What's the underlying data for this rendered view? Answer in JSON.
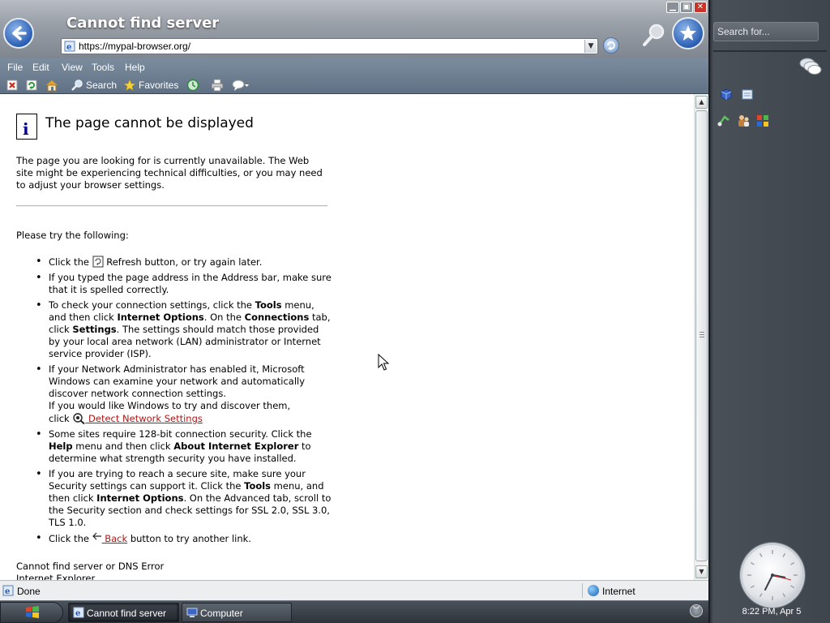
{
  "window": {
    "title": "Cannot find server",
    "address": "https://mypal-browser.org/",
    "controls": {
      "minimize": "▁",
      "maximize": "▣",
      "close": "✕"
    }
  },
  "menubar": {
    "items": [
      "File",
      "Edit",
      "View",
      "Tools",
      "Help"
    ]
  },
  "toolbar": {
    "search_label": "Search",
    "favorites_label": "Favorites"
  },
  "page": {
    "heading": "The page cannot be displayed",
    "intro": "The page you are looking for is currently unavailable. The Web site might be experiencing technical difficulties, or you may need to adjust your browser settings.",
    "try_label": "Please try the following:",
    "tip1_pre": "Click the ",
    "tip1_post": " Refresh button, or try again later.",
    "tip2": "If you typed the page address in the Address bar, make sure that it is spelled correctly.",
    "tip3_a": "To check your connection settings, click the ",
    "tip3_b": "Tools",
    "tip3_c": " menu, and then click ",
    "tip3_d": "Internet Options",
    "tip3_e": ". On the ",
    "tip3_f": "Connections",
    "tip3_g": " tab, click ",
    "tip3_h": "Settings",
    "tip3_i": ". The settings should match those provided by your local area network (LAN) administrator or Internet service provider (ISP).",
    "tip4_a": "If your Network Administrator has enabled it, Microsoft Windows can examine your network and automatically discover network connection settings.",
    "tip4_b": "If you would like Windows to try and discover them,",
    "tip4_c": "click ",
    "tip4_link": " Detect Network Settings",
    "tip5_a": "Some sites require 128-bit connection security. Click the ",
    "tip5_b": "Help",
    "tip5_c": " menu and then click ",
    "tip5_d": "About Internet Explorer",
    "tip5_e": " to determine what strength security you have installed.",
    "tip6_a": "If you are trying to reach a secure site, make sure your Security settings can support it. Click the ",
    "tip6_b": "Tools",
    "tip6_c": " menu, and then click ",
    "tip6_d": "Internet Options",
    "tip6_e": ". On the Advanced tab, scroll to the Security section and check settings for SSL 2.0, SSL 3.0, TLS 1.0.",
    "tip7_pre": "Click the ",
    "tip7_link": " Back",
    "tip7_post": " button to try another link.",
    "footer_line1": "Cannot find server or DNS Error",
    "footer_line2": "Internet Explorer"
  },
  "statusbar": {
    "status": "Done",
    "zone": "Internet"
  },
  "sidebar": {
    "search_placeholder": "Search for...",
    "clock_time": "8:22 PM, Apr 5"
  },
  "taskbar": {
    "task1": "Cannot find server",
    "task2": "Computer"
  },
  "icons": [
    "back-arrow-icon",
    "favorites-star-icon",
    "search-magnifier-icon",
    "go-refresh-icon",
    "stop-icon",
    "refresh-icon",
    "home-icon",
    "search-icon",
    "favorites-icon",
    "history-icon",
    "print-icon",
    "messenger-icon",
    "info-icon",
    "globe-icon",
    "windows-logo-icon",
    "clock-icon"
  ],
  "colors": {
    "link": "#b01818",
    "title_bar": "#9aa0a8",
    "sidebar": "#3f454d"
  }
}
